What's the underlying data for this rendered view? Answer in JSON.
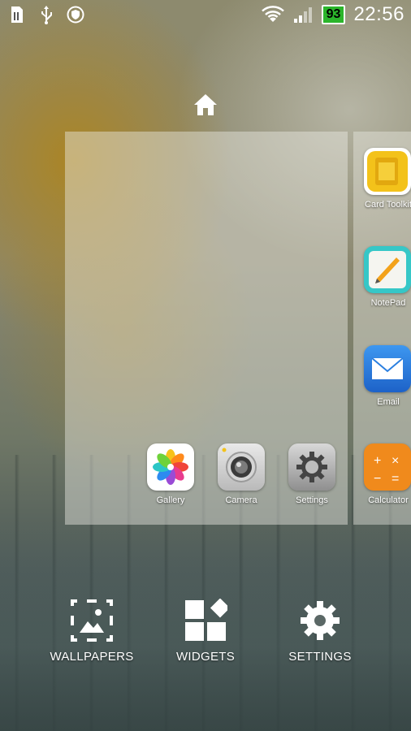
{
  "status_bar": {
    "left_icons": [
      "sim-icon",
      "usb-icon",
      "shield-icon"
    ],
    "right_icons": [
      "wifi-icon",
      "signal-icon"
    ],
    "battery_level": "93",
    "time": "22:56"
  },
  "home_screen_preview": {
    "apps": [
      {
        "label": "Gallery",
        "icon": "gallery-icon"
      },
      {
        "label": "Camera",
        "icon": "camera-icon"
      },
      {
        "label": "Settings",
        "icon": "settings-gear-icon"
      }
    ]
  },
  "next_page": {
    "apps": [
      {
        "label": "Card Toolkit",
        "icon": "sim-card-icon",
        "color": "#f3c21a"
      },
      {
        "label": "NotePad",
        "icon": "notepad-icon",
        "color": "#36c7c7"
      },
      {
        "label": "Email",
        "icon": "email-icon",
        "color": "#2b7fe0"
      },
      {
        "label": "Calculator",
        "icon": "calculator-icon",
        "color": "#f08a1c"
      }
    ]
  },
  "bottom_actions": [
    {
      "label": "WALLPAPERS",
      "icon": "wallpapers-icon"
    },
    {
      "label": "WIDGETS",
      "icon": "widgets-icon"
    },
    {
      "label": "SETTINGS",
      "icon": "settings-icon"
    }
  ]
}
